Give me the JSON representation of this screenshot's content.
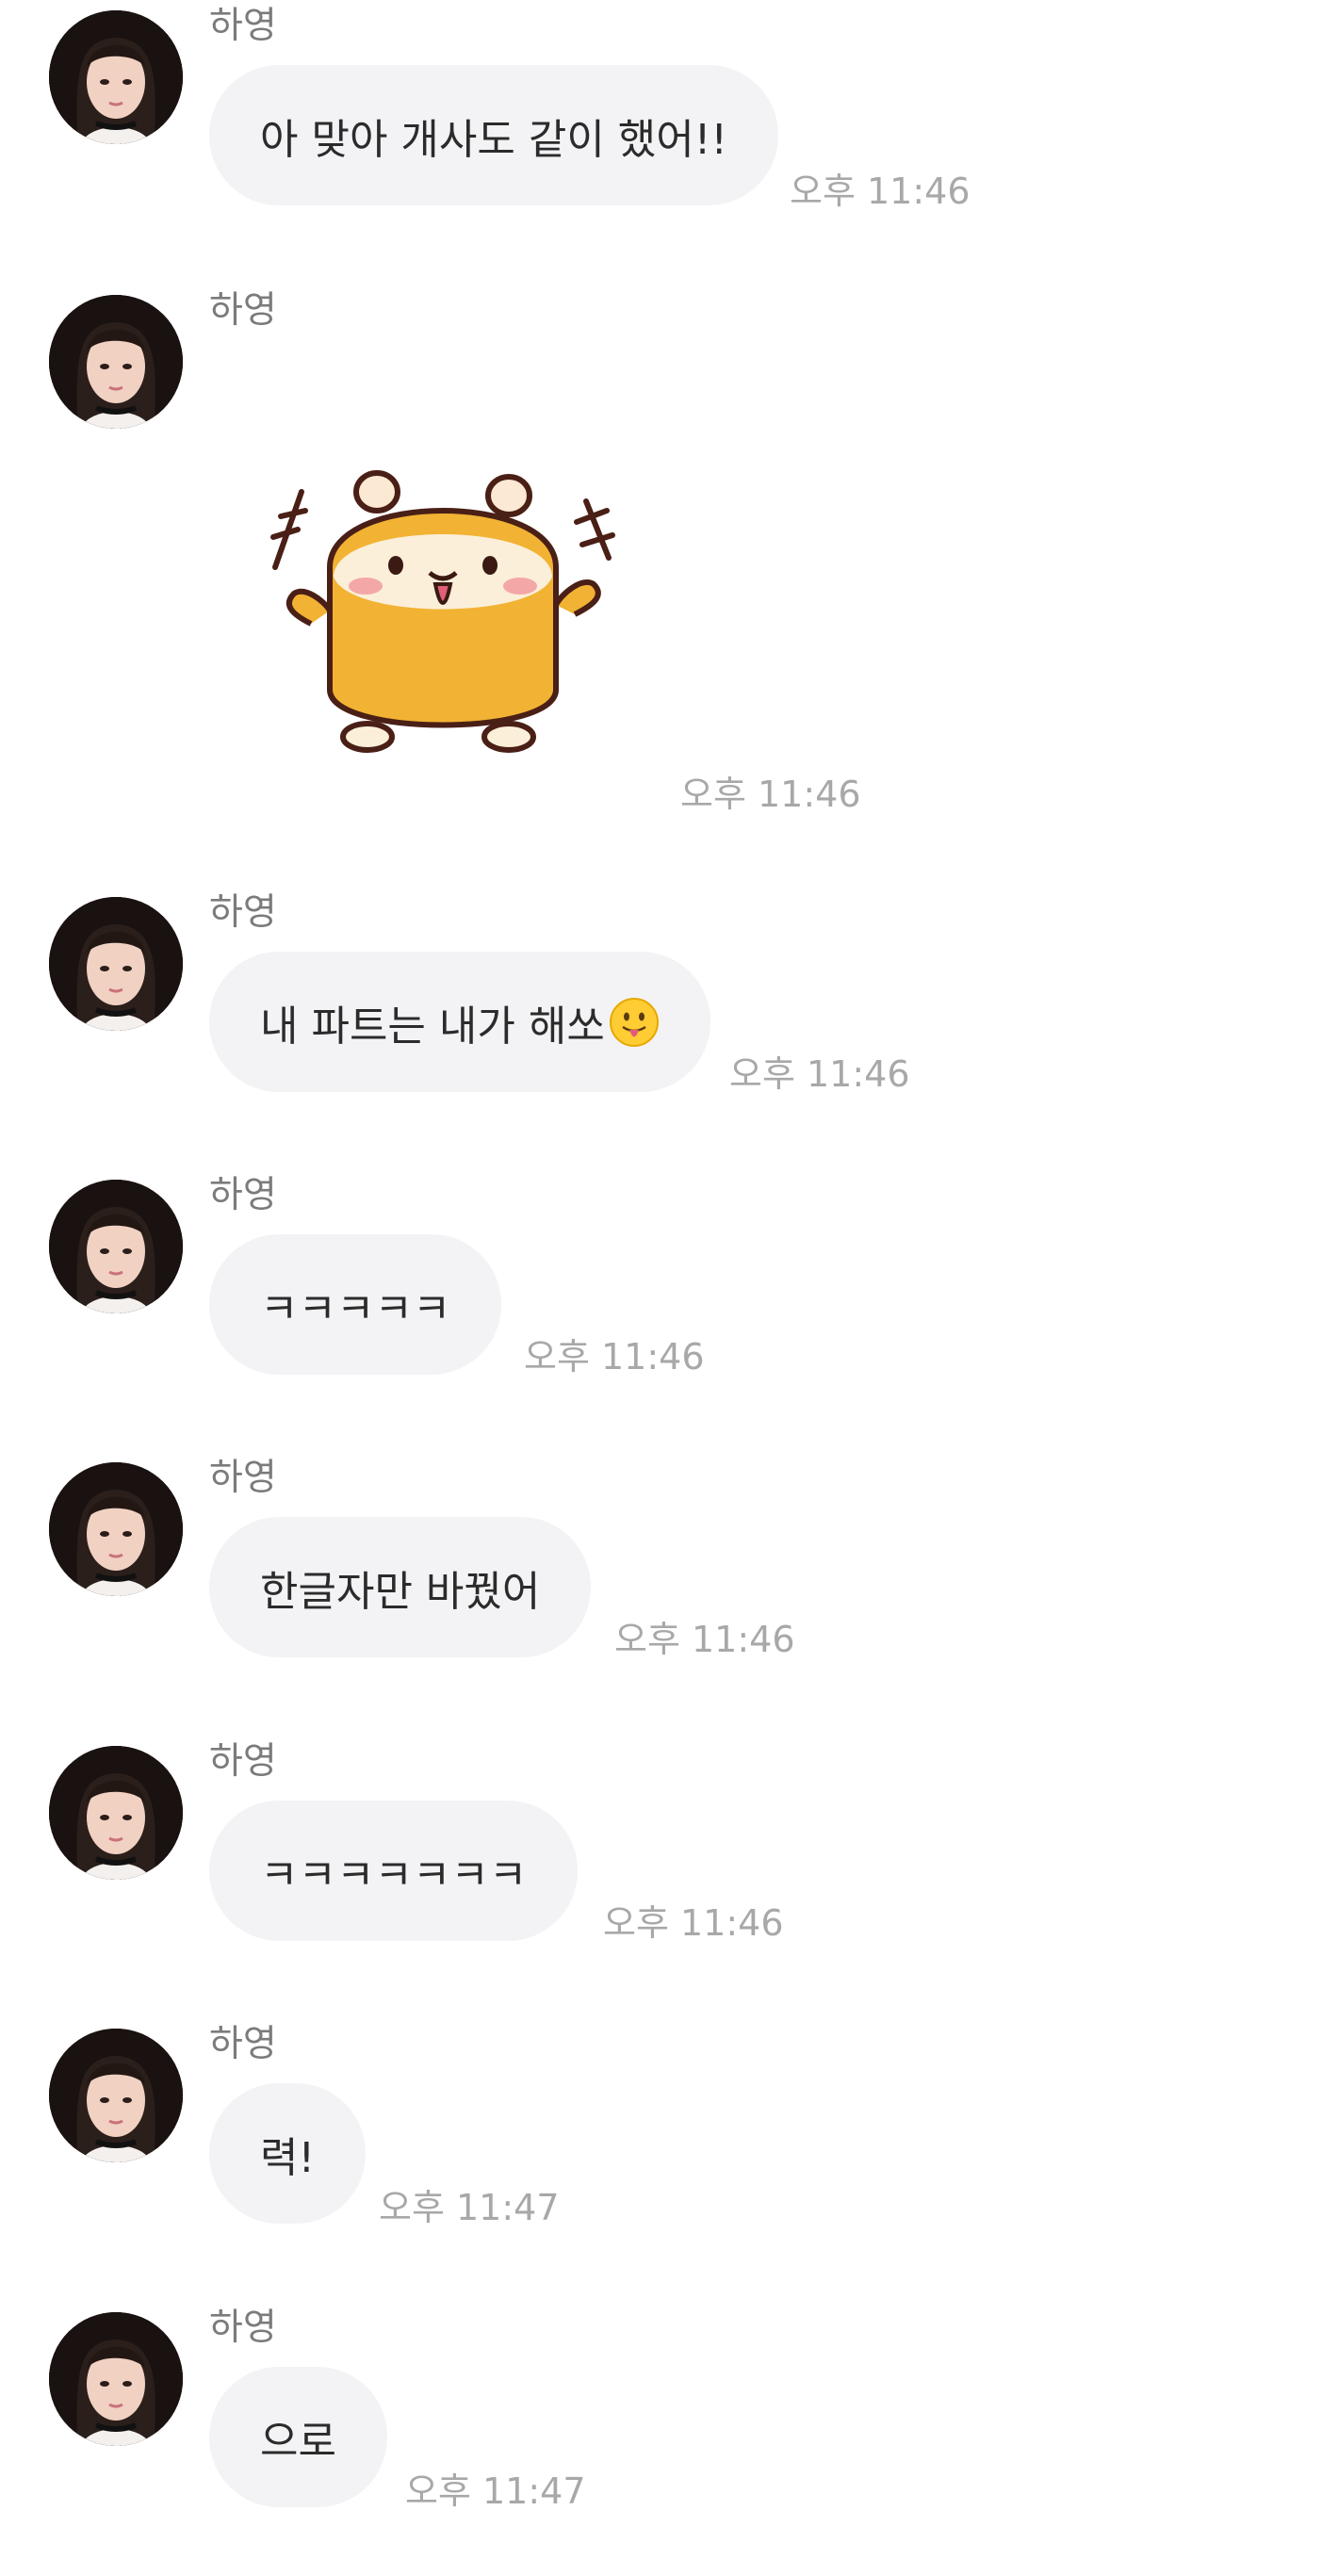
{
  "chat": {
    "messages": [
      {
        "sender": "하영",
        "text": "아 맞아 개사도 같이 했어!!",
        "time": "오후 11:46"
      },
      {
        "sender": "하영",
        "sticker": "hamster-cheer-sticker",
        "time": "오후 11:46"
      },
      {
        "sender": "하영",
        "text": "내 파트는 내가 해쏘",
        "emoji": "tongue-out-face-icon",
        "time": "오후 11:46"
      },
      {
        "sender": "하영",
        "text": "ㅋㅋㅋㅋㅋ",
        "time": "오후 11:46"
      },
      {
        "sender": "하영",
        "text": "한글자만 바꿨어",
        "time": "오후 11:46"
      },
      {
        "sender": "하영",
        "text": "ㅋㅋㅋㅋㅋㅋㅋ",
        "time": "오후 11:46"
      },
      {
        "sender": "하영",
        "text": "력!",
        "time": "오후 11:47"
      },
      {
        "sender": "하영",
        "text": "으로",
        "time": "오후 11:47"
      }
    ]
  },
  "colors": {
    "bubble_background": "#f3f3f5",
    "message_text": "#2b2b2b",
    "sender_text": "#7b7b7b",
    "time_text": "#a8a8a8"
  }
}
